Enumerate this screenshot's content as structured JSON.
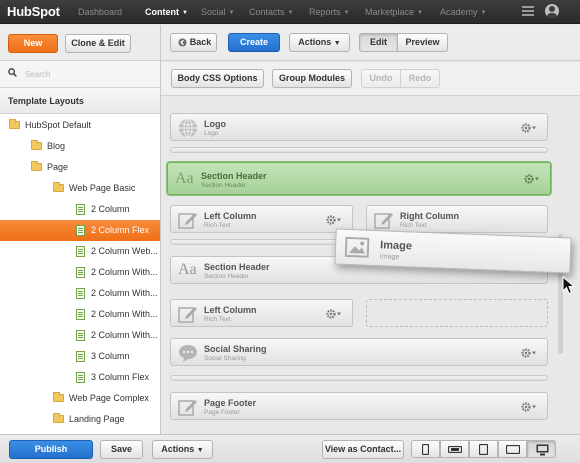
{
  "topnav": {
    "logo_text": "HubSpot",
    "items": [
      {
        "label": "Dashboard",
        "active": false
      },
      {
        "label": "Content",
        "active": true
      },
      {
        "label": "Social",
        "active": false
      },
      {
        "label": "Contacts",
        "active": false
      },
      {
        "label": "Reports",
        "active": false
      },
      {
        "label": "Marketplace",
        "active": false
      },
      {
        "label": "Academy",
        "active": false
      }
    ]
  },
  "sidebar": {
    "new_label": "New",
    "clone_label": "Clone & Edit",
    "search_placeholder": "Search",
    "heading": "Template Layouts",
    "tree": [
      {
        "label": "HubSpot Default",
        "type": "folder"
      },
      {
        "label": "Blog",
        "type": "folder"
      },
      {
        "label": "Page",
        "type": "folder"
      },
      {
        "label": "Web Page Basic",
        "type": "folder"
      },
      {
        "label": "2 Column",
        "type": "page"
      },
      {
        "label": "2 Column Flex",
        "type": "page",
        "selected": true
      },
      {
        "label": "2 Column Web...",
        "type": "page"
      },
      {
        "label": "2 Column With...",
        "type": "page"
      },
      {
        "label": "2 Column With...",
        "type": "page"
      },
      {
        "label": "2 Column With...",
        "type": "page"
      },
      {
        "label": "2 Column With...",
        "type": "page"
      },
      {
        "label": "3 Column",
        "type": "page"
      },
      {
        "label": "3 Column Flex",
        "type": "page"
      },
      {
        "label": "Web Page Complex",
        "type": "folder"
      },
      {
        "label": "Landing Page",
        "type": "folder"
      }
    ]
  },
  "toolbar": {
    "back_label": "Back",
    "create_label": "Create",
    "actions_label": "Actions",
    "edit_label": "Edit",
    "preview_label": "Preview",
    "body_css_label": "Body CSS Options",
    "group_modules_label": "Group Modules",
    "undo_label": "Undo",
    "redo_label": "Redo"
  },
  "modules": {
    "logo": {
      "title": "Logo",
      "sub": "Logo"
    },
    "section_header_1": {
      "title": "Section Header",
      "sub": "Section Header"
    },
    "left_column_1": {
      "title": "Left Column",
      "sub": "Rich Text"
    },
    "right_column": {
      "title": "Right Column",
      "sub": "Rich Text"
    },
    "section_header_2": {
      "title": "Section Header",
      "sub": "Section Header"
    },
    "left_column_2": {
      "title": "Left Column",
      "sub": "Rich Text"
    },
    "social_sharing": {
      "title": "Social Sharing",
      "sub": "Social Sharing"
    },
    "page_footer": {
      "title": "Page Footer",
      "sub": "Page Footer"
    },
    "dragging_image": {
      "title": "Image",
      "sub": "Image"
    }
  },
  "bottom": {
    "publish_label": "Publish",
    "save_label": "Save",
    "actions_label": "Actions",
    "view_as_label": "View as Contact...",
    "active_device": "desktop"
  },
  "colors": {
    "accent_orange": "#f57722",
    "primary_blue": "#2a7ad8",
    "drop_target_green": "#a7d199"
  }
}
